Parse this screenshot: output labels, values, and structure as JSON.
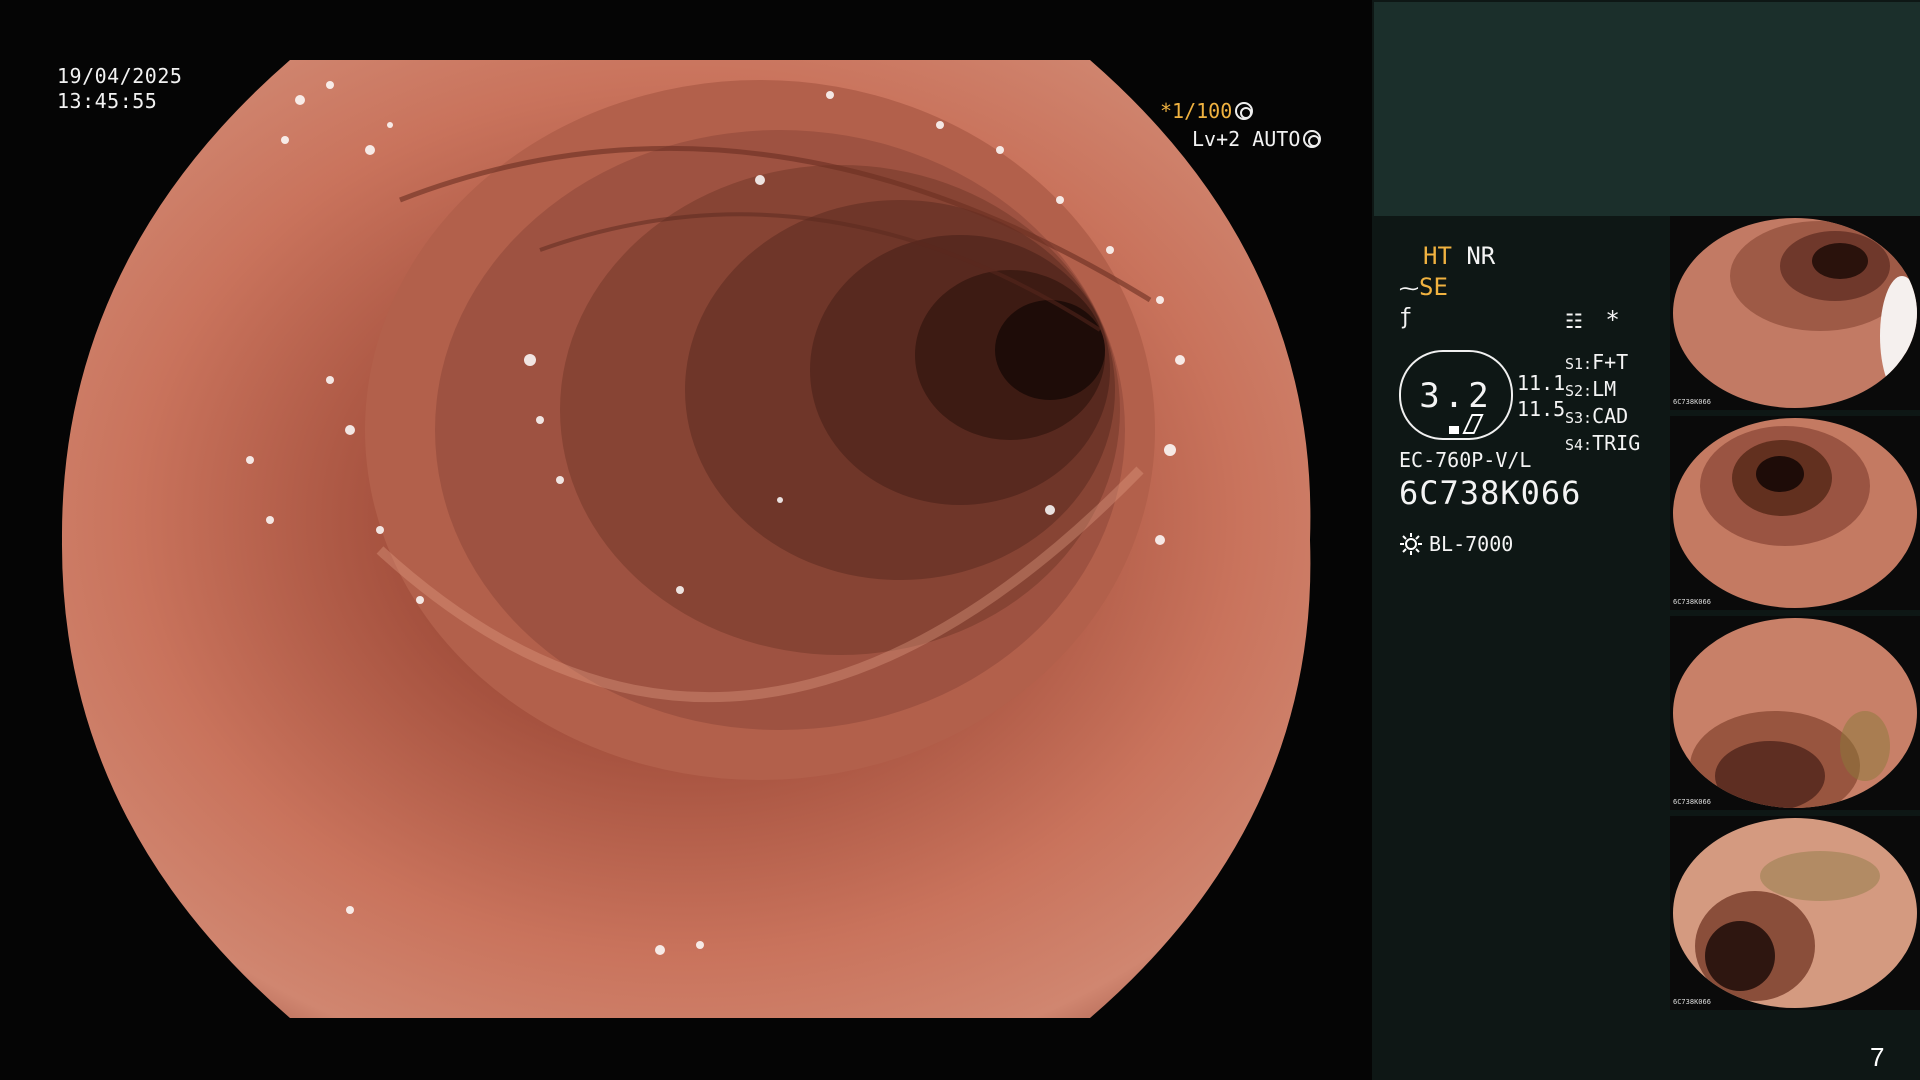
{
  "osd": {
    "date": "19/04/2025",
    "time": "13:45:55",
    "shutter": "*1/100",
    "agc": "Lv+2 AUTO"
  },
  "info": {
    "ht": "HT",
    "nr": "NR",
    "se": "SE",
    "gauge_value": "3.2",
    "val_1": "11.1",
    "val_2": "11.5",
    "s_items": [
      {
        "key": "S1:",
        "value": "F+T"
      },
      {
        "key": "S2:",
        "value": "LM"
      },
      {
        "key": "S3:",
        "value": "CAD"
      },
      {
        "key": "S4:",
        "value": "TRIG"
      }
    ],
    "scope_model": "EC-760P-V/L",
    "scope_serial": "6C738K066",
    "light_source": "BL-7000"
  },
  "thumbnails": [
    {
      "label": "6C738K066"
    },
    {
      "label": "6C738K066"
    },
    {
      "label": "6C738K066"
    },
    {
      "label": "6C738K066"
    }
  ],
  "page_number": "7",
  "colors": {
    "panel_bg": "#0e1715",
    "panel_top": "#1b2f2b",
    "accent_orange": "#f0b240",
    "mucosa": "#c8705a"
  }
}
